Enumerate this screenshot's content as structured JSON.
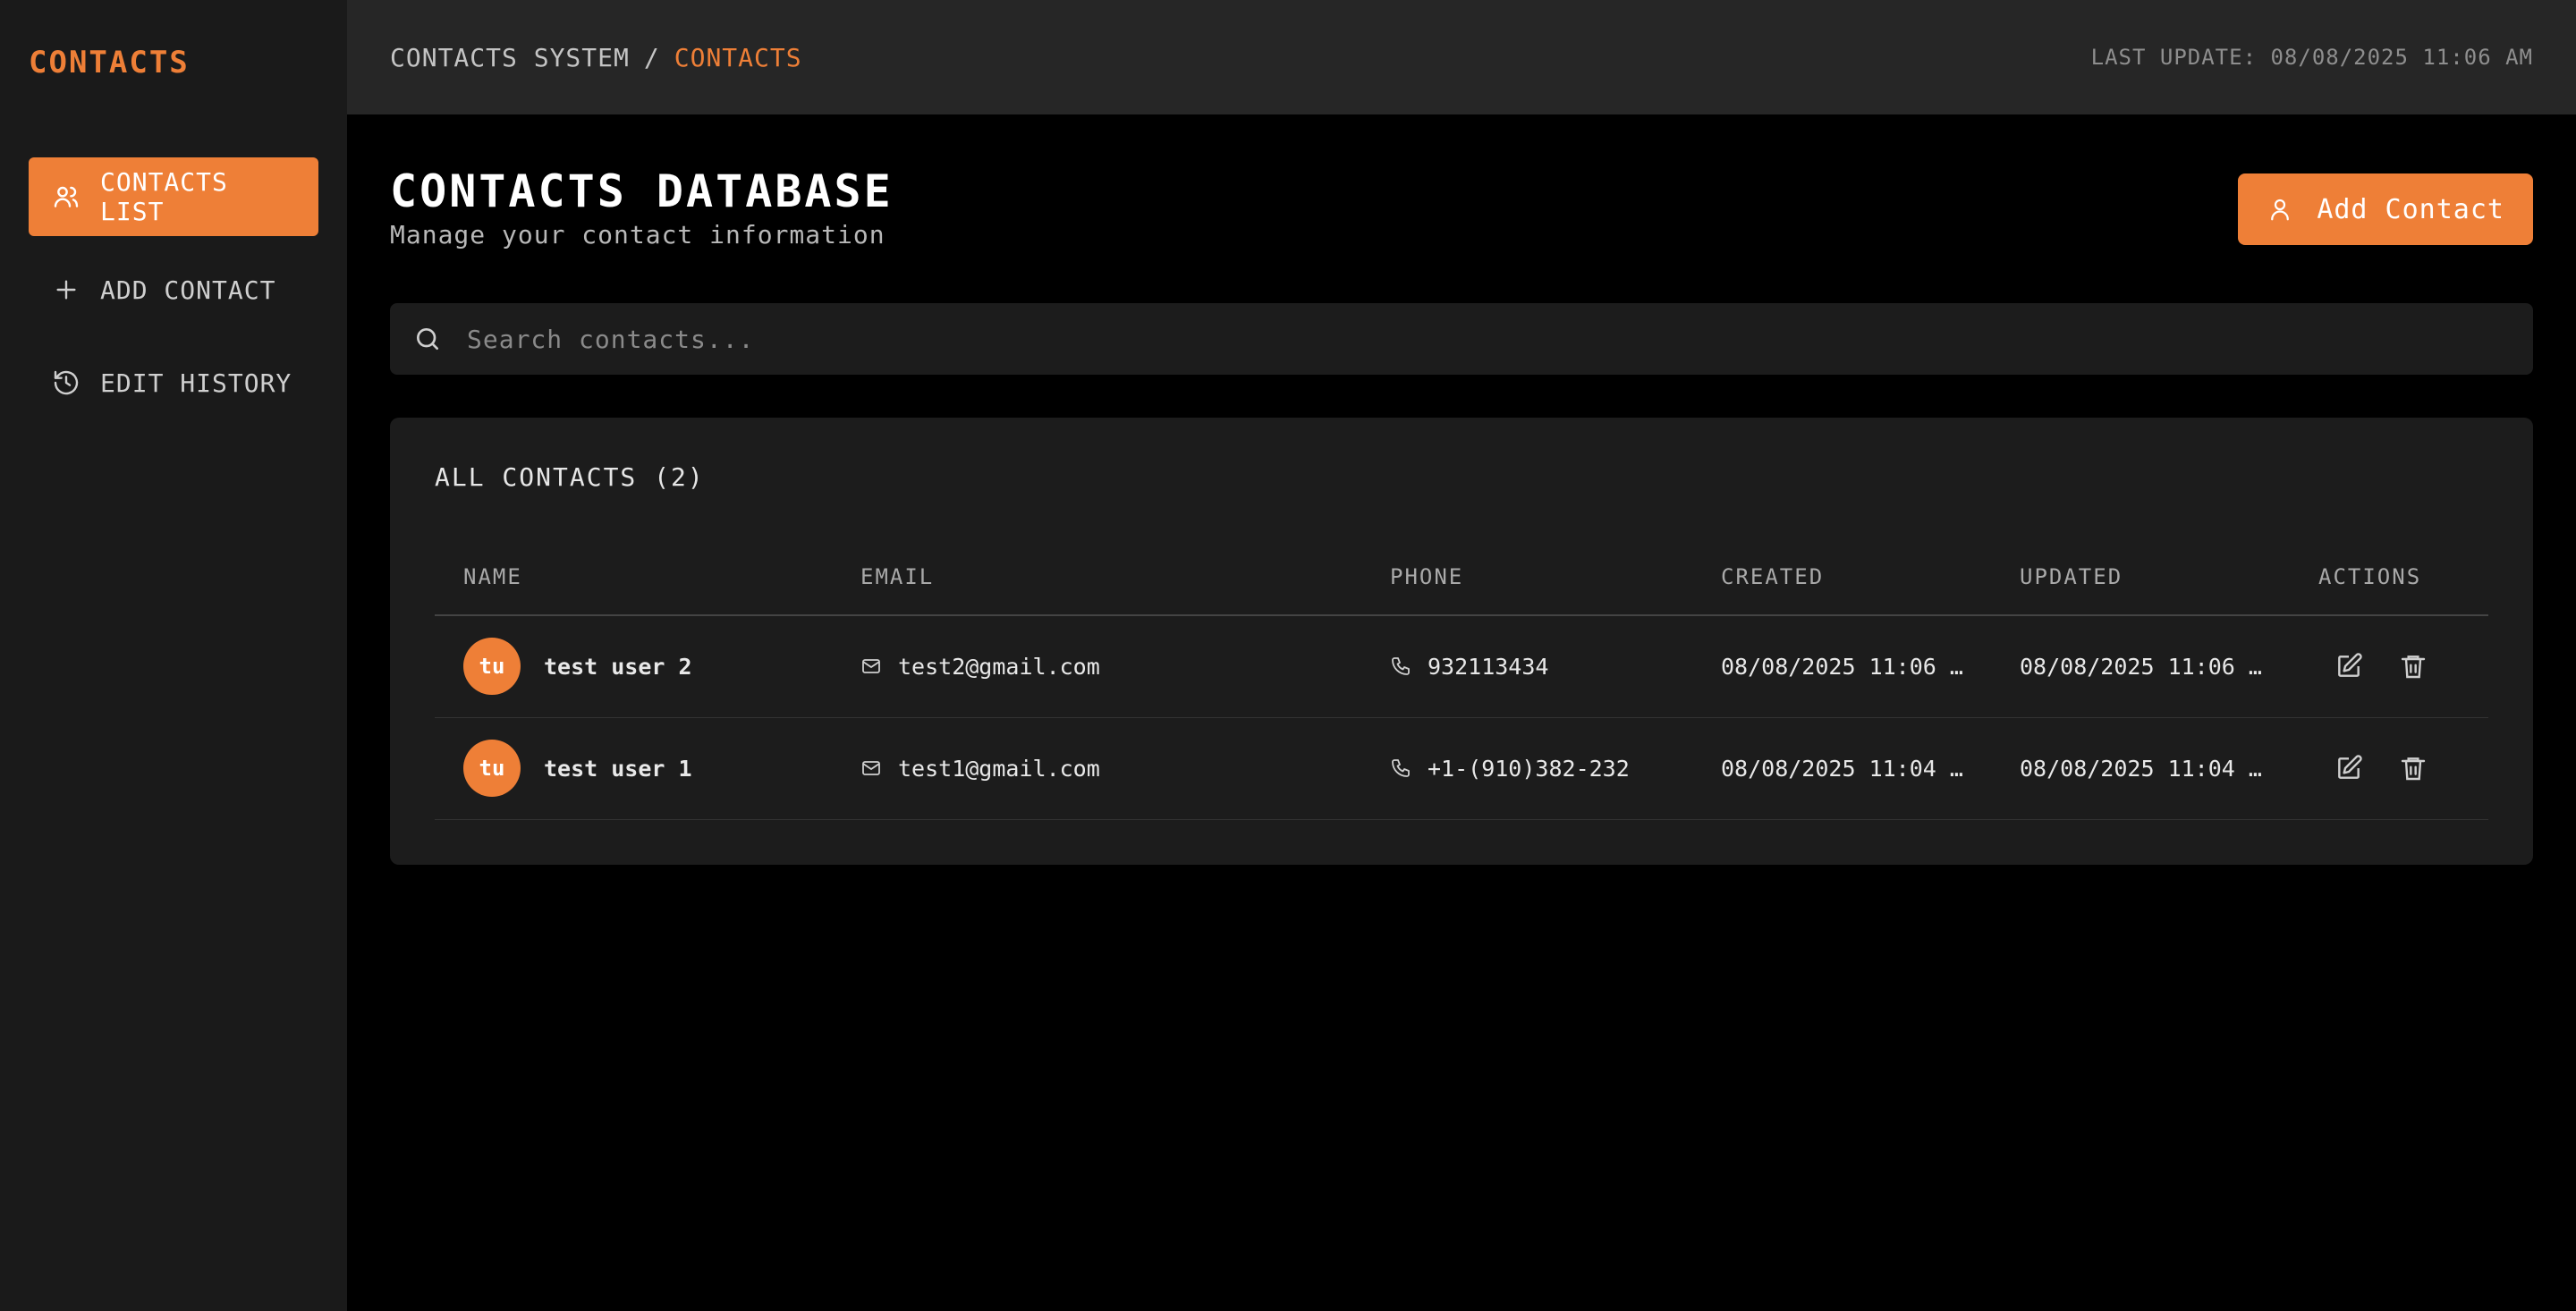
{
  "sidebar": {
    "brand": "CONTACTS",
    "items": [
      {
        "label": "CONTACTS LIST",
        "icon": "users-icon",
        "active": true
      },
      {
        "label": "ADD CONTACT",
        "icon": "plus-icon",
        "active": false
      },
      {
        "label": "EDIT HISTORY",
        "icon": "history-icon",
        "active": false
      }
    ]
  },
  "header": {
    "breadcrumb_root": "CONTACTS SYSTEM",
    "breadcrumb_sep": "/",
    "breadcrumb_current": "CONTACTS",
    "last_update": "LAST UPDATE: 08/08/2025 11:06 AM"
  },
  "page": {
    "title": "CONTACTS DATABASE",
    "subtitle": "Manage your contact information",
    "add_button_label": "Add Contact"
  },
  "search": {
    "placeholder": "Search contacts...",
    "value": ""
  },
  "table": {
    "title": "ALL CONTACTS (2)",
    "columns": [
      "NAME",
      "EMAIL",
      "PHONE",
      "CREATED",
      "UPDATED",
      "ACTIONS"
    ],
    "rows": [
      {
        "initials": "tu",
        "name": "test user 2",
        "email": "test2@gmail.com",
        "phone": "932113434",
        "created": "08/08/2025 11:06 …",
        "updated": "08/08/2025 11:06 …"
      },
      {
        "initials": "tu",
        "name": "test user 1",
        "email": "test1@gmail.com",
        "phone": "+1-(910)382-232",
        "created": "08/08/2025 11:04 …",
        "updated": "08/08/2025 11:04 …"
      }
    ]
  },
  "colors": {
    "accent": "#ee7f37",
    "sidebar_bg": "#1a1a1a",
    "topbar_bg": "#262626",
    "page_bg": "#000000",
    "card_bg": "#1c1c1c"
  }
}
